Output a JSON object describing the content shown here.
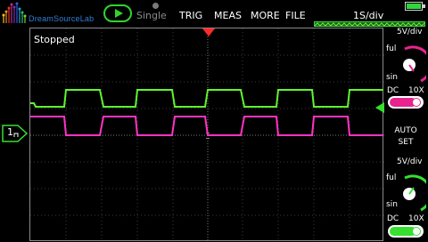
{
  "brand": {
    "name": "DreamSourceLab"
  },
  "toolbar": {
    "single_label": "Single",
    "trig_label": "TRIG",
    "meas_label": "MEAS",
    "more_label": "MORE",
    "file_label": "FILE",
    "timebase": "1S/div"
  },
  "scope": {
    "status": "Stopped"
  },
  "channel1": {
    "marker_label": "1"
  },
  "channel_panel_top": {
    "vdiv": "5V/div",
    "ful_label": "ful",
    "sin_label": "sin",
    "coupling": "DC",
    "probe": "10X",
    "color": "#e8238f"
  },
  "auto_set": {
    "line1": "AUTO",
    "line2": "SET"
  },
  "channel_panel_bottom": {
    "vdiv": "5V/div",
    "ful_label": "ful",
    "sin_label": "sin",
    "coupling": "DC",
    "probe": "10X",
    "color": "#35e02f"
  },
  "colors": {
    "ch_green": "#5ff52f",
    "ch_magenta": "#ff33c4",
    "accent_green": "#31d42e",
    "trigger_red": "#ff2a2a"
  },
  "waveforms": {
    "green_levels_high": "approx 5 divisions duty cycle square wave",
    "magenta_levels": "inverted square wave"
  }
}
